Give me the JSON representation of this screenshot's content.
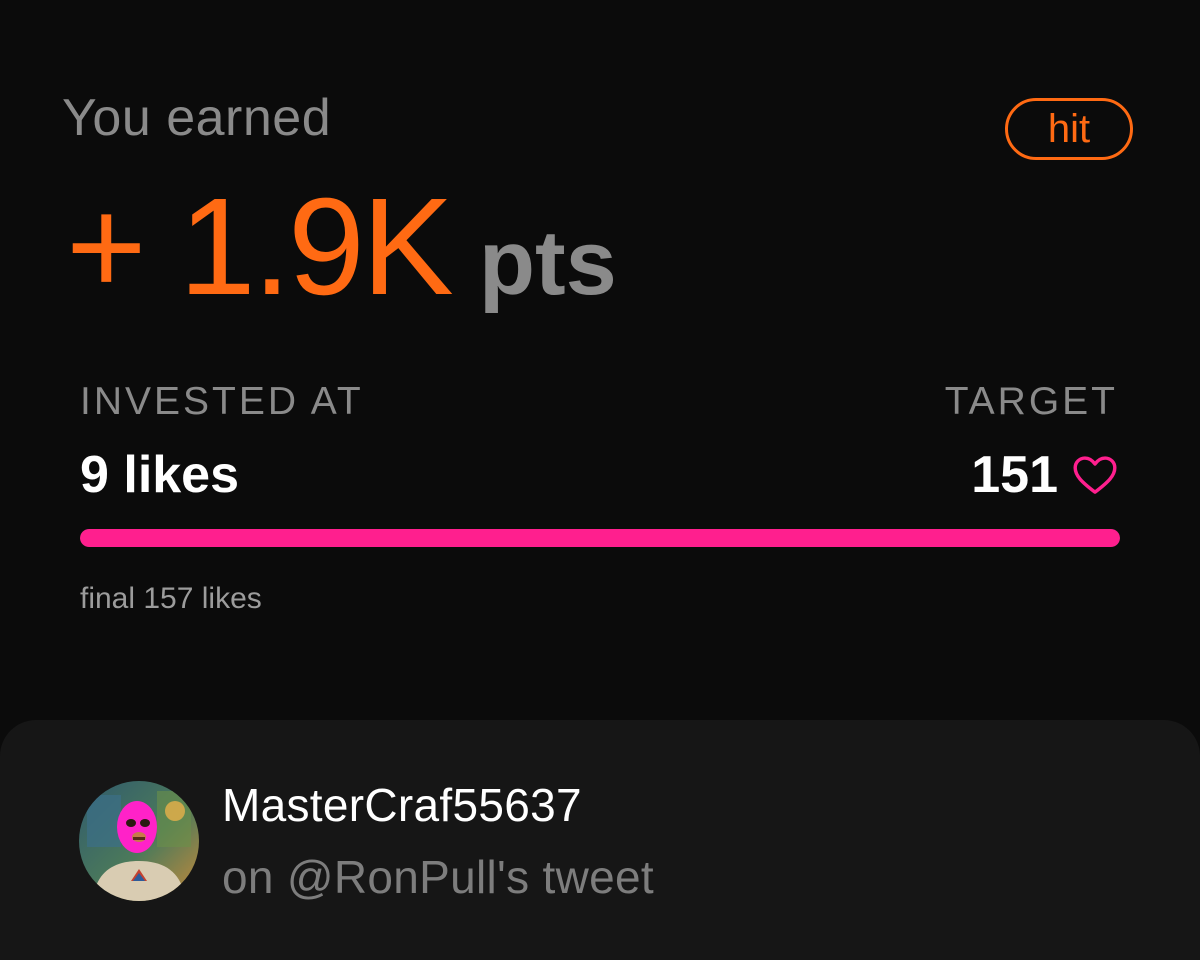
{
  "earned": {
    "label": "You earned",
    "amount": "+ 1.9K",
    "unit": "pts",
    "status_badge": "hit"
  },
  "investment": {
    "invested_label": "INVESTED AT",
    "invested_value": "9 likes",
    "target_label": "TARGET",
    "target_value": "151",
    "progress_fraction": 1.0,
    "final_text": "final 157 likes"
  },
  "tweet": {
    "username": "MasterCraf55637",
    "reference": "on @RonPull's tweet"
  },
  "icons": {
    "target": "heart-icon",
    "user": "avatar"
  },
  "colors": {
    "accent_orange": "#ff6a13",
    "progress_pink": "#ff1f8e",
    "background": "#0b0b0b",
    "card_background": "#161616",
    "muted_text": "#8a8a8a"
  }
}
